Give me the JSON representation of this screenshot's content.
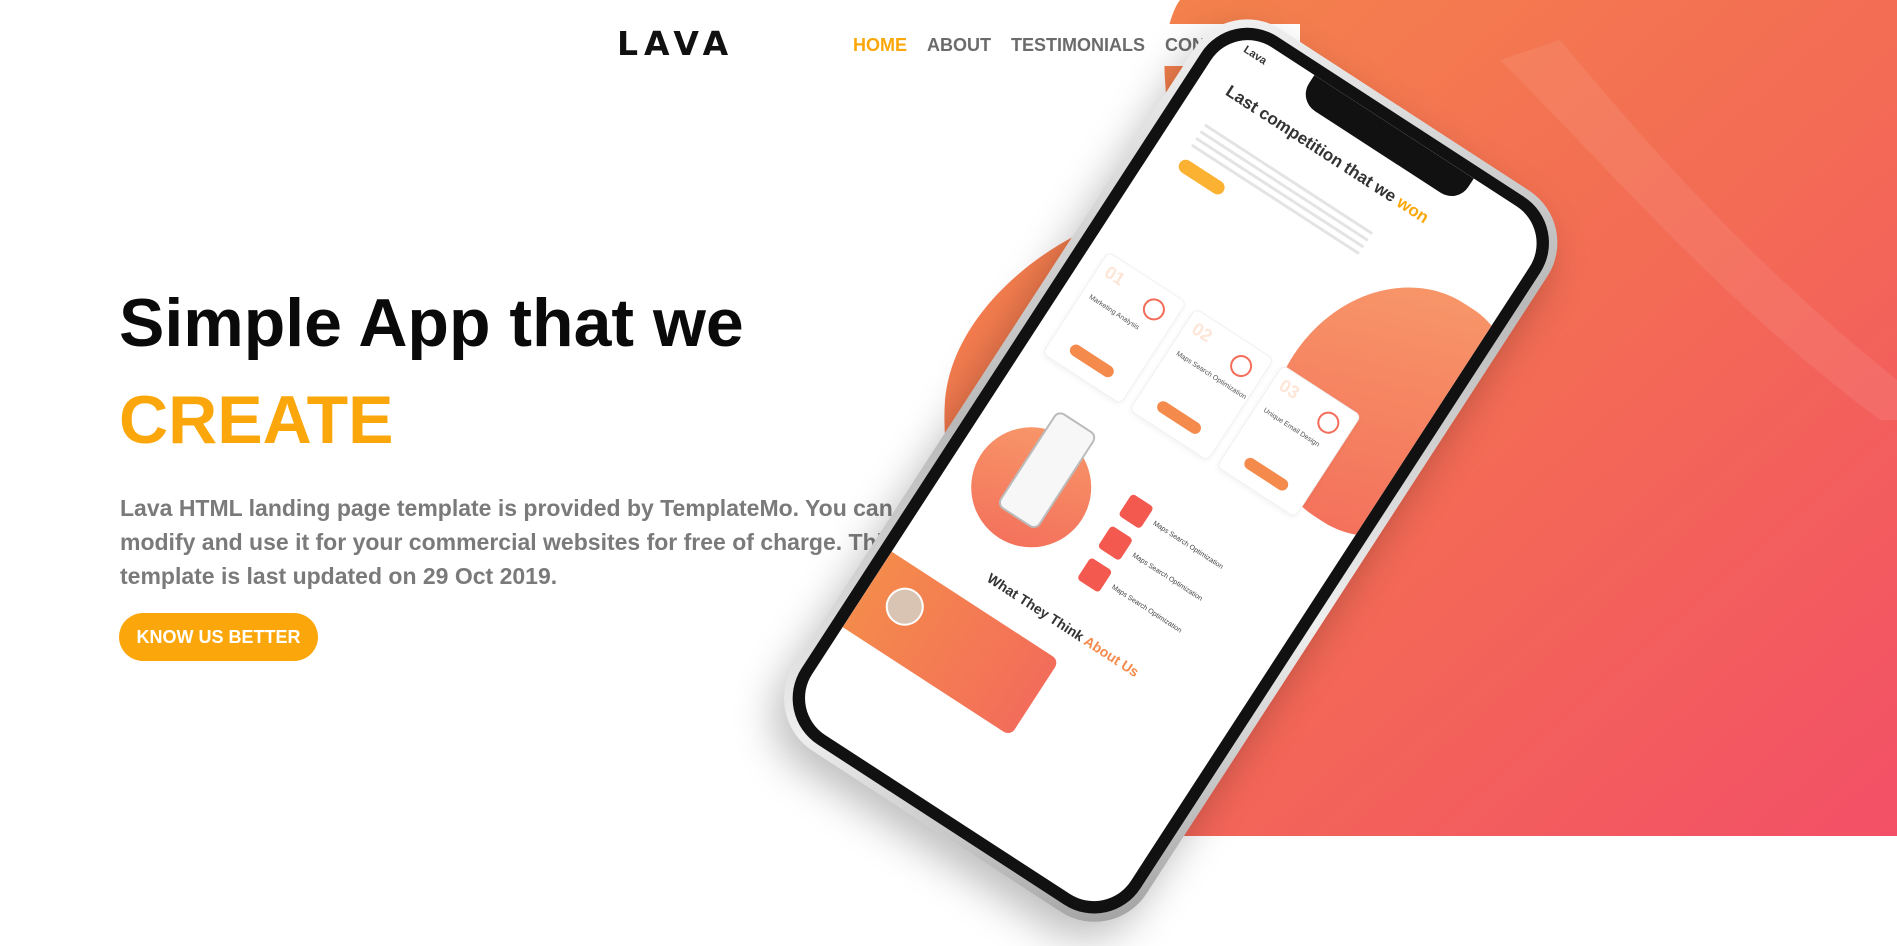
{
  "header": {
    "logo": "LAVA",
    "nav": [
      {
        "label": "HOME",
        "active": true
      },
      {
        "label": "ABOUT",
        "active": false
      },
      {
        "label": "TESTIMONIALS",
        "active": false
      },
      {
        "label": "CONTACT US",
        "active": false
      }
    ]
  },
  "hero": {
    "title_line1": "Simple App that we",
    "title_line2": "CREATE",
    "description": "Lava HTML landing page template is provided by TemplateMo. You can modify and use it for your commercial websites for free of charge. This template is last updated on 29 Oct 2019.",
    "cta_label": "KNOW US BETTER"
  },
  "phone_screen": {
    "brand": "Lava",
    "headline_prefix": "Last competition that we ",
    "headline_accent": "won",
    "cards": [
      {
        "num": "01",
        "label": "Marketing Analysis"
      },
      {
        "num": "02",
        "label": "Maps Search Optimization"
      },
      {
        "num": "03",
        "label": "Unique Email Design"
      }
    ],
    "list": [
      "Maps Search Optimization",
      "Maps Search Optimization",
      "Maps Search Optimization"
    ],
    "section_title_prefix": "What They Think ",
    "section_title_accent": "About Us"
  },
  "colors": {
    "accent": "#fba70b",
    "gradient_start": "#f48a4c",
    "gradient_end": "#f35a63",
    "text_dark": "#0a0a0a",
    "text_muted": "#7a7a7a"
  }
}
